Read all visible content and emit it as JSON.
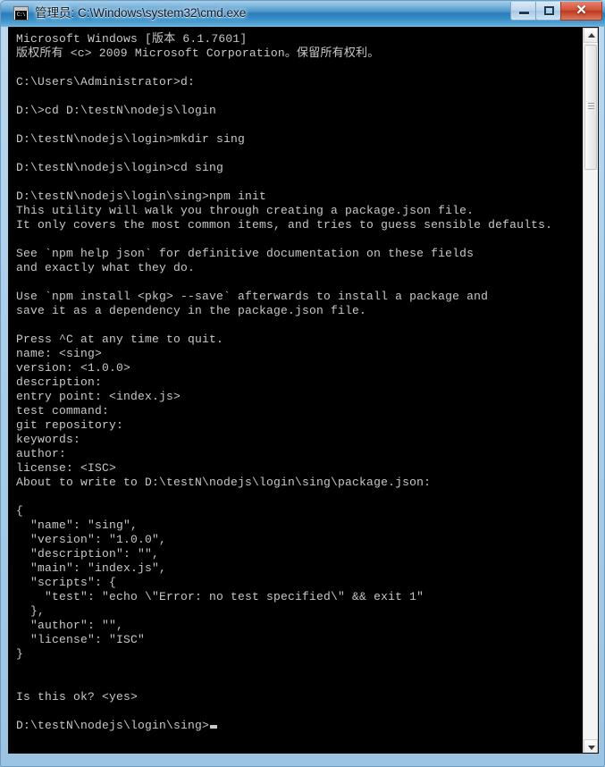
{
  "window": {
    "title": "管理员: C:\\Windows\\system32\\cmd.exe",
    "icon_label": "C:\\",
    "icon_name": "cmd-console-icon",
    "controls": {
      "minimize_label": "–",
      "restore_label": "□",
      "close_label": "✕"
    }
  },
  "colors": {
    "console_background": "#000000",
    "console_text": "#c8c8c8",
    "titlebar_blue": "#2d7cb8",
    "close_button_red": "#bc3a20",
    "frame_blue": "#a9cde8"
  },
  "console": {
    "prompt_cwd": "D:\\testN\\nodejs\\login\\sing>",
    "scrollbar": {
      "up_arrow": "up-arrow-icon",
      "down_arrow": "down-arrow-icon",
      "thumb_position_percent": 2
    },
    "lines": [
      "Microsoft Windows [版本 6.1.7601]",
      "版权所有 <c> 2009 Microsoft Corporation。保留所有权利。",
      "",
      "C:\\Users\\Administrator>d:",
      "",
      "D:\\>cd D:\\testN\\nodejs\\login",
      "",
      "D:\\testN\\nodejs\\login>mkdir sing",
      "",
      "D:\\testN\\nodejs\\login>cd sing",
      "",
      "D:\\testN\\nodejs\\login\\sing>npm init",
      "This utility will walk you through creating a package.json file.",
      "It only covers the most common items, and tries to guess sensible defaults.",
      "",
      "See `npm help json` for definitive documentation on these fields",
      "and exactly what they do.",
      "",
      "Use `npm install <pkg> --save` afterwards to install a package and",
      "save it as a dependency in the package.json file.",
      "",
      "Press ^C at any time to quit.",
      "name: <sing>",
      "version: <1.0.0>",
      "description:",
      "entry point: <index.js>",
      "test command:",
      "git repository:",
      "keywords:",
      "author:",
      "license: <ISC>",
      "About to write to D:\\testN\\nodejs\\login\\sing\\package.json:",
      "",
      "{",
      "  \"name\": \"sing\",",
      "  \"version\": \"1.0.0\",",
      "  \"description\": \"\",",
      "  \"main\": \"index.js\",",
      "  \"scripts\": {",
      "    \"test\": \"echo \\\"Error: no test specified\\\" && exit 1\"",
      "  },",
      "  \"author\": \"\",",
      "  \"license\": \"ISC\"",
      "}",
      "",
      "",
      "Is this ok? <yes>",
      "",
      "D:\\testN\\nodejs\\login\\sing>"
    ]
  }
}
